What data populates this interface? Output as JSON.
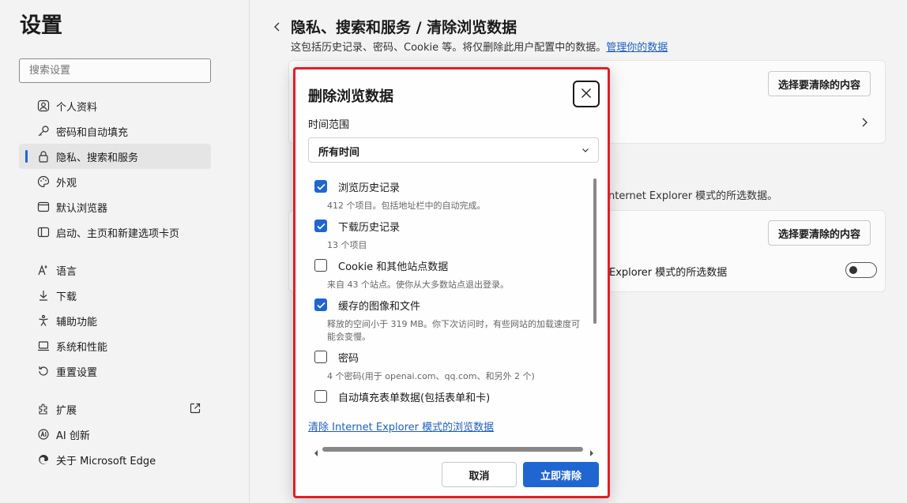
{
  "sidebar": {
    "title": "设置",
    "search_placeholder": "搜索设置",
    "group1": [
      {
        "label": "个人资料",
        "icon": "profile-icon"
      },
      {
        "label": "密码和自动填充",
        "icon": "key-icon"
      },
      {
        "label": "隐私、搜索和服务",
        "icon": "lock-icon",
        "active": true
      },
      {
        "label": "外观",
        "icon": "appearance-icon"
      },
      {
        "label": "默认浏览器",
        "icon": "browser-icon"
      },
      {
        "label": "启动、主页和新建选项卡页",
        "icon": "home-tab-icon"
      }
    ],
    "group2": [
      {
        "label": "语言",
        "icon": "language-icon"
      },
      {
        "label": "下载",
        "icon": "download-icon"
      },
      {
        "label": "辅助功能",
        "icon": "accessibility-icon"
      },
      {
        "label": "系统和性能",
        "icon": "laptop-icon"
      },
      {
        "label": "重置设置",
        "icon": "reset-icon"
      }
    ],
    "group3": [
      {
        "label": "扩展",
        "icon": "extensions-icon"
      },
      {
        "label": "AI 创新",
        "icon": "ai-icon"
      },
      {
        "label": "关于 Microsoft Edge",
        "icon": "edge-icon"
      }
    ]
  },
  "main": {
    "title": "隐私、搜索和服务 / 清除浏览数据",
    "subtitle": "这包括历史记录、密码、Cookie 等。将仅删除此用户配置中的数据。",
    "subtitle_link": "管理你的数据",
    "card1_button": "选择要清除的内容",
    "section2_text": "nternet Explorer 模式的所选数据。",
    "card2_button": "选择要清除的内容",
    "card2_row_text": "Explorer 模式的所选数据"
  },
  "dialog": {
    "title": "删除浏览数据",
    "time_label": "时间范围",
    "time_value": "所有时间",
    "items": [
      {
        "label": "浏览历史记录",
        "desc": "412 个项目。包括地址栏中的自动完成。",
        "checked": true
      },
      {
        "label": "下载历史记录",
        "desc": "13 个项目",
        "checked": true
      },
      {
        "label": "Cookie 和其他站点数据",
        "desc": "来自 43 个站点。使你从大多数站点退出登录。",
        "checked": false
      },
      {
        "label": "缓存的图像和文件",
        "desc": "释放的空间小于 319 MB。你下次访问时，有些网站的加载速度可能会变慢。",
        "checked": true
      },
      {
        "label": "密码",
        "desc": "4 个密码(用于 openai.com、qq.com、和另外 2 个)",
        "checked": false
      },
      {
        "label": "自动填充表单数据(包括表单和卡)",
        "desc": "",
        "checked": false
      }
    ],
    "ie_link": "清除 Internet Explorer 模式的浏览数据",
    "cancel_label": "取消",
    "clear_label": "立即清除"
  },
  "colors": {
    "accent": "#1f66d1",
    "highlight_border": "#e21f26"
  }
}
